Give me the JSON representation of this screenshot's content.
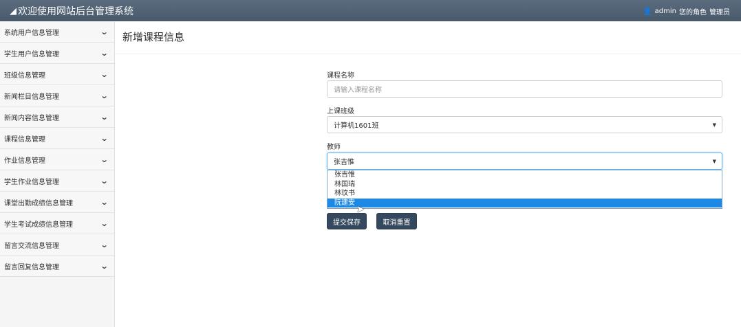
{
  "header": {
    "title": "欢迎使用网站后台管理系统",
    "user_name": "admin",
    "role_label": "您的角色",
    "role_value": "管理员"
  },
  "sidebar": {
    "items": [
      {
        "label": "系统用户信息管理"
      },
      {
        "label": "学生用户信息管理"
      },
      {
        "label": "班级信息管理"
      },
      {
        "label": "新闻栏目信息管理"
      },
      {
        "label": "新闻内容信息管理"
      },
      {
        "label": "课程信息管理"
      },
      {
        "label": "作业信息管理"
      },
      {
        "label": "学生作业信息管理"
      },
      {
        "label": "课堂出勤成绩信息管理"
      },
      {
        "label": "学生考试成绩信息管理"
      },
      {
        "label": "留言交流信息管理"
      },
      {
        "label": "留言回复信息管理"
      }
    ]
  },
  "main": {
    "title": "新增课程信息",
    "form": {
      "course_name_label": "课程名称",
      "course_name_placeholder": "请输入课程名称",
      "class_label": "上课班级",
      "class_value": "计算机1601班",
      "teacher_label": "教师",
      "teacher_value": "张吉惟",
      "teacher_options": [
        "张吉惟",
        "林国瑞",
        "林玟书",
        "阮建安"
      ],
      "highlighted_option": "阮建安",
      "submit_label": "提交保存",
      "reset_label": "取消重置"
    }
  }
}
